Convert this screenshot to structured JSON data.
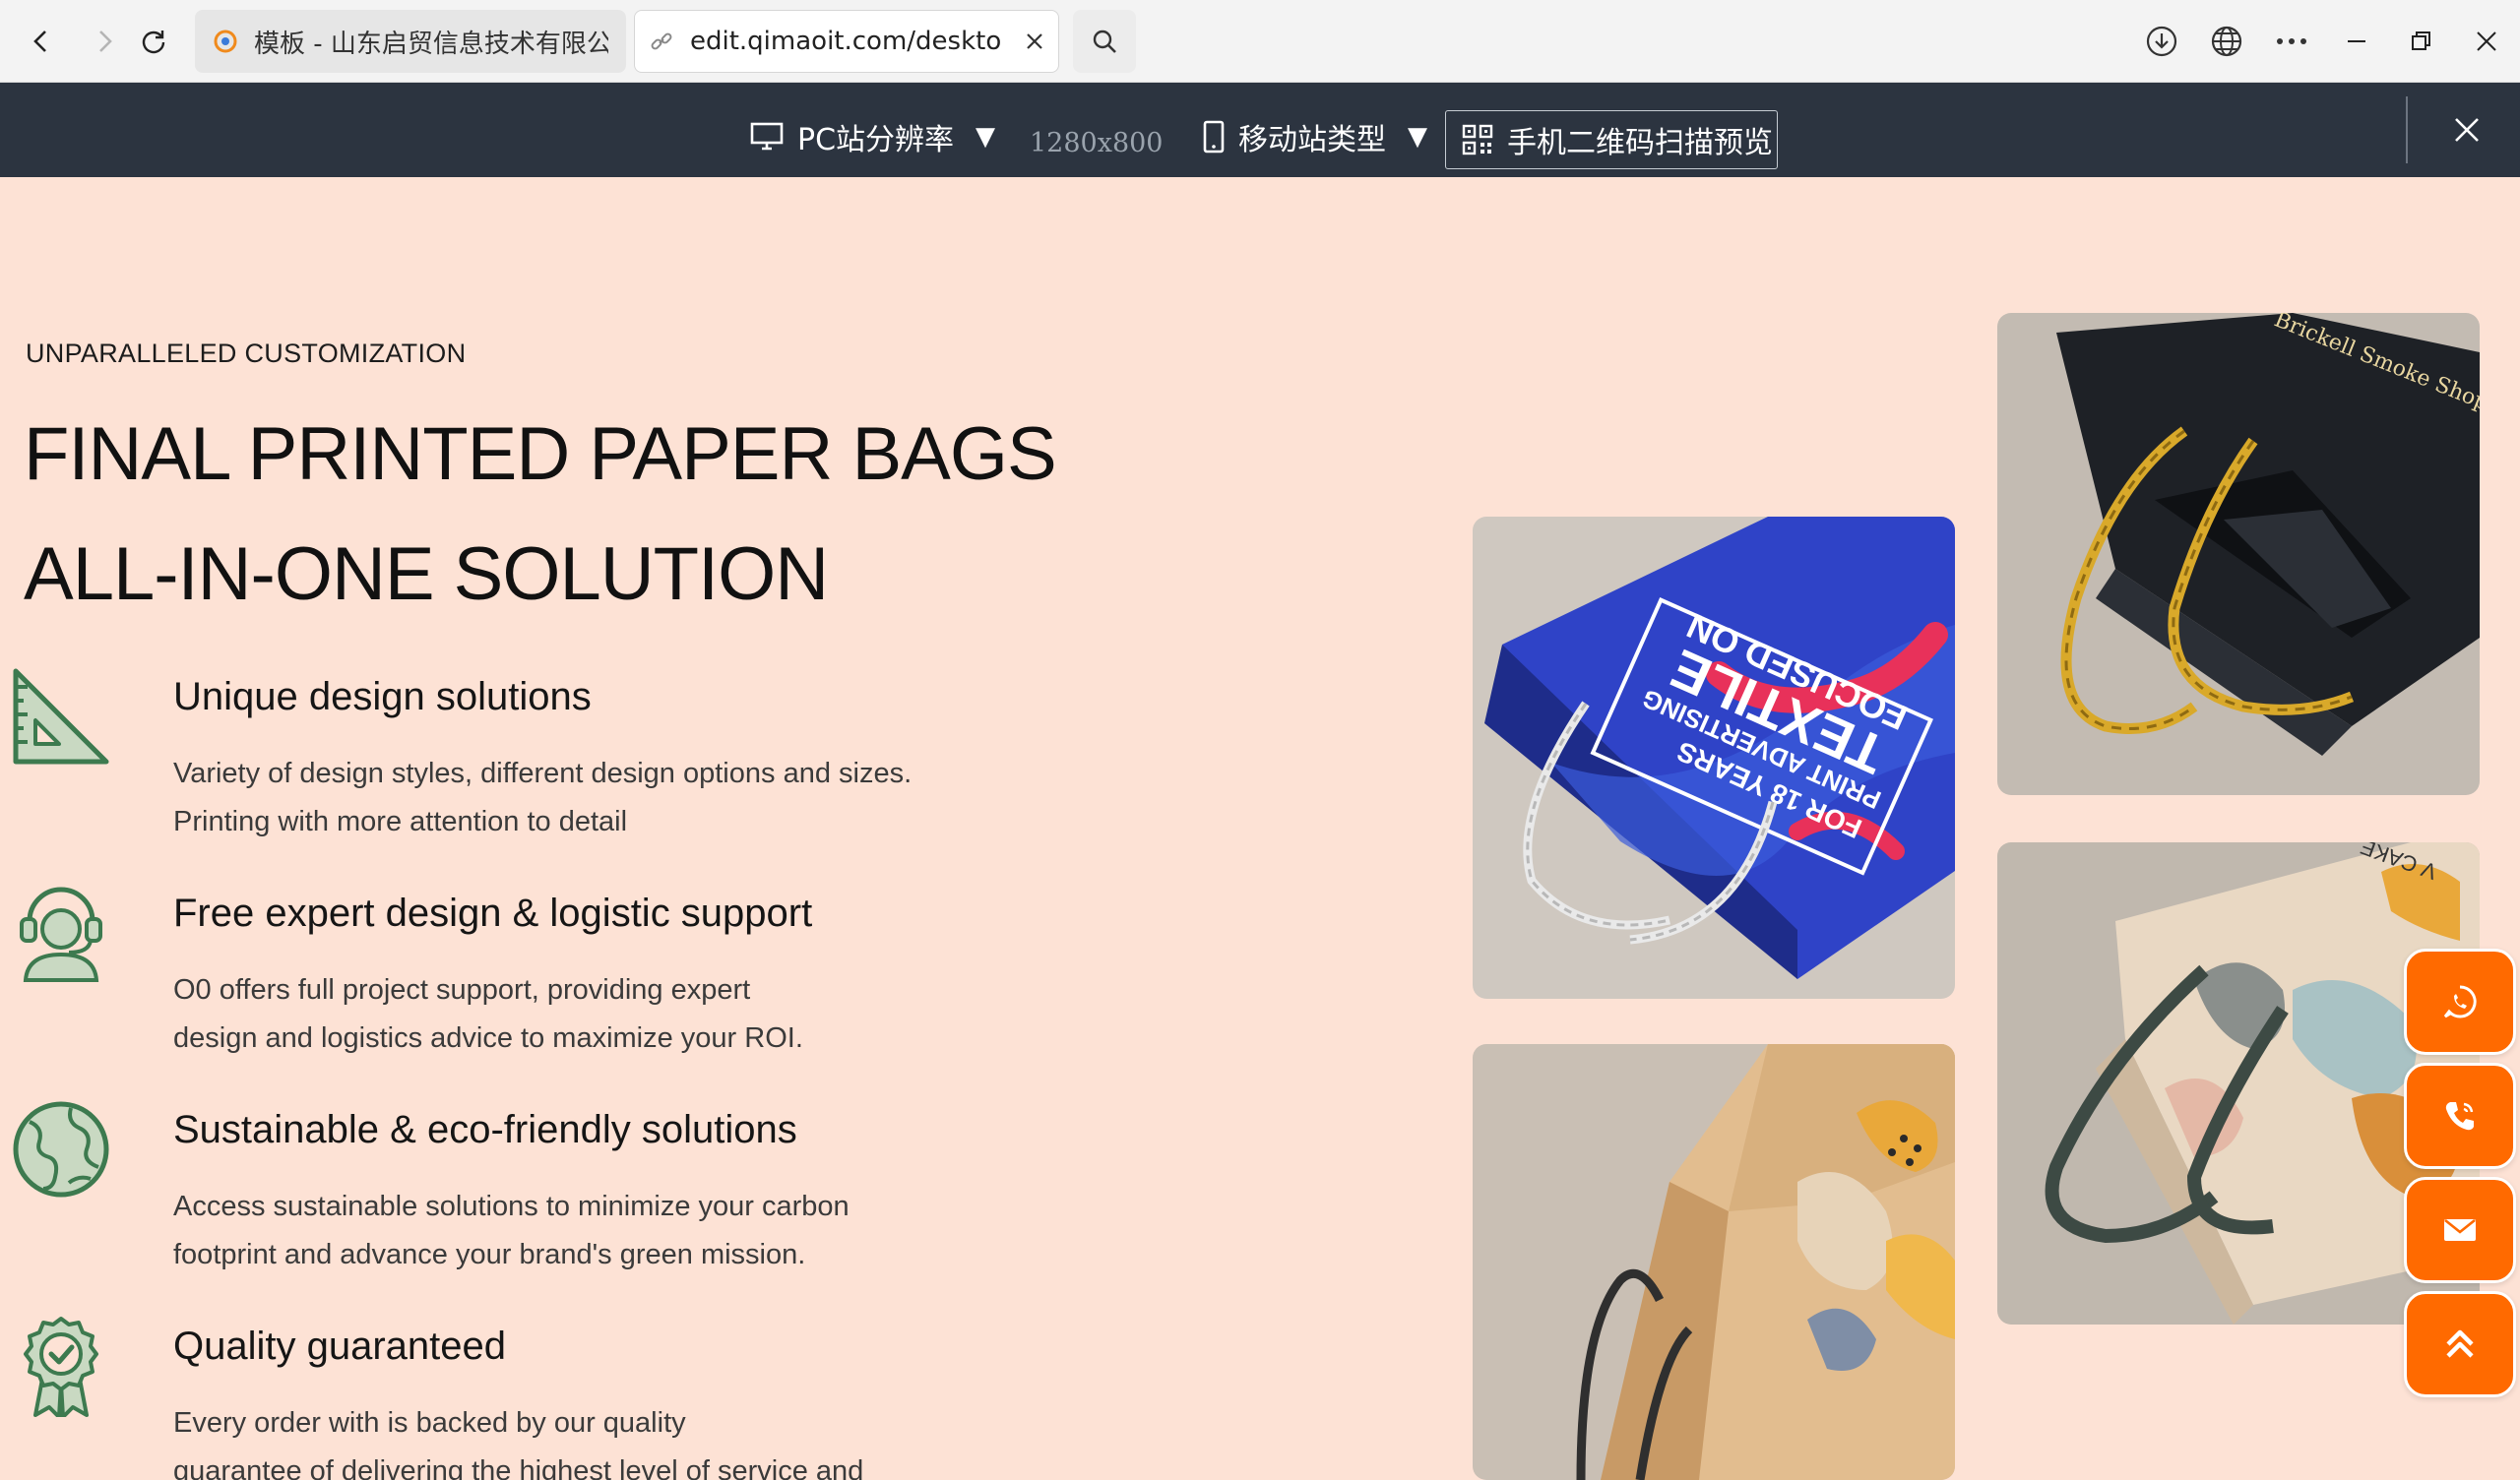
{
  "browser": {
    "tabs": [
      {
        "title": "模板 - 山东启贸信息技术有限公司"
      },
      {
        "title": "edit.qimaoit.com/desktop/h"
      }
    ]
  },
  "preview_toolbar": {
    "pc_resolution_label": "PC站分辨率",
    "resolution_value": "1280x800",
    "mobile_type_label": "移动站类型",
    "qr_preview_label": "手机二维码扫描预览"
  },
  "hero": {
    "eyebrow": "UNPARALLELED CUSTOMIZATION",
    "headline_line1": "FINAL PRINTED PAPER BAGS",
    "headline_line2": "ALL-IN-ONE SOLUTION"
  },
  "features": [
    {
      "icon": "set-square-ruler-icon",
      "title": "Unique design solutions",
      "desc_line1": "Variety of design styles, different design options and sizes.",
      "desc_line2": "Printing with more attention to detail"
    },
    {
      "icon": "support-agent-headset-icon",
      "title": "Free expert design & logistic support",
      "desc_line1": "O0 offers full project support, providing expert",
      "desc_line2": "design and logistics advice to maximize your ROI."
    },
    {
      "icon": "globe-earth-icon",
      "title": "Sustainable & eco-friendly solutions",
      "desc_line1": "Access sustainable solutions to minimize your carbon",
      "desc_line2": "footprint and advance your brand's green mission."
    },
    {
      "icon": "award-badge-check-icon",
      "title": "Quality guaranteed",
      "desc_line1": "Every order with is backed by our quality",
      "desc_line2": "guarantee of delivering the highest level of service and"
    }
  ],
  "images": {
    "blue_bag_print_line1": "FOR 18 YEARS",
    "blue_bag_print_line2": "PRINT ADVERTISING",
    "blue_bag_print_line3": "TEXTILE",
    "blue_bag_print_line4": "FOCUSED ON",
    "black_bag_print": "Brickell Smoke Shop",
    "jute_bag_print": "V CAKE"
  },
  "floating_buttons": [
    {
      "icon": "whatsapp-icon"
    },
    {
      "icon": "phone-icon"
    },
    {
      "icon": "mail-icon"
    },
    {
      "icon": "back-to-top-icon"
    }
  ],
  "colors": {
    "page_background": "#fde2d5",
    "preview_bar": "#2c3440",
    "icon_green": "#3d7a4f",
    "float_orange": "#ff6a00",
    "blue_bag": "#2f43c7",
    "black_bag": "#1e2126",
    "rope_gold": "#d9a92a"
  }
}
